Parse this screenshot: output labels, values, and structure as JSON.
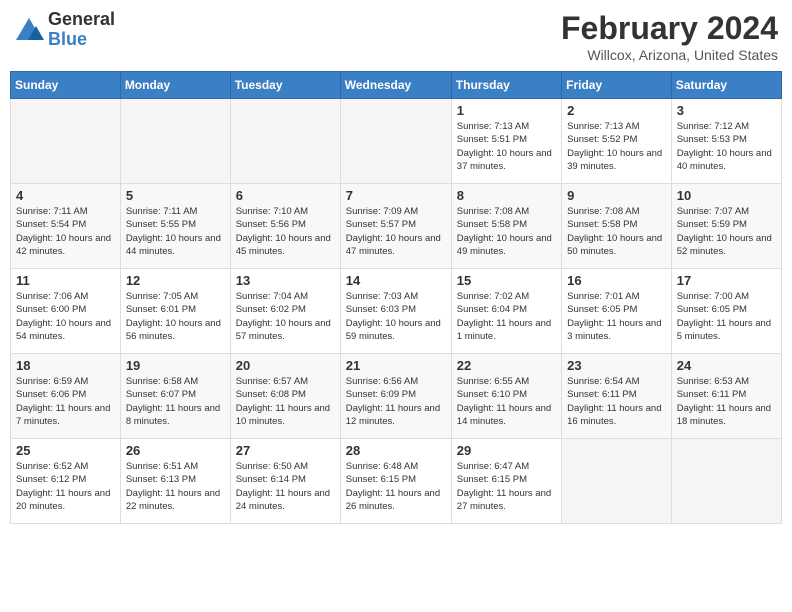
{
  "header": {
    "logo_general": "General",
    "logo_blue": "Blue",
    "month_title": "February 2024",
    "location": "Willcox, Arizona, United States"
  },
  "weekdays": [
    "Sunday",
    "Monday",
    "Tuesday",
    "Wednesday",
    "Thursday",
    "Friday",
    "Saturday"
  ],
  "weeks": [
    [
      {
        "day": "",
        "info": ""
      },
      {
        "day": "",
        "info": ""
      },
      {
        "day": "",
        "info": ""
      },
      {
        "day": "",
        "info": ""
      },
      {
        "day": "1",
        "info": "Sunrise: 7:13 AM\nSunset: 5:51 PM\nDaylight: 10 hours\nand 37 minutes."
      },
      {
        "day": "2",
        "info": "Sunrise: 7:13 AM\nSunset: 5:52 PM\nDaylight: 10 hours\nand 39 minutes."
      },
      {
        "day": "3",
        "info": "Sunrise: 7:12 AM\nSunset: 5:53 PM\nDaylight: 10 hours\nand 40 minutes."
      }
    ],
    [
      {
        "day": "4",
        "info": "Sunrise: 7:11 AM\nSunset: 5:54 PM\nDaylight: 10 hours\nand 42 minutes."
      },
      {
        "day": "5",
        "info": "Sunrise: 7:11 AM\nSunset: 5:55 PM\nDaylight: 10 hours\nand 44 minutes."
      },
      {
        "day": "6",
        "info": "Sunrise: 7:10 AM\nSunset: 5:56 PM\nDaylight: 10 hours\nand 45 minutes."
      },
      {
        "day": "7",
        "info": "Sunrise: 7:09 AM\nSunset: 5:57 PM\nDaylight: 10 hours\nand 47 minutes."
      },
      {
        "day": "8",
        "info": "Sunrise: 7:08 AM\nSunset: 5:58 PM\nDaylight: 10 hours\nand 49 minutes."
      },
      {
        "day": "9",
        "info": "Sunrise: 7:08 AM\nSunset: 5:58 PM\nDaylight: 10 hours\nand 50 minutes."
      },
      {
        "day": "10",
        "info": "Sunrise: 7:07 AM\nSunset: 5:59 PM\nDaylight: 10 hours\nand 52 minutes."
      }
    ],
    [
      {
        "day": "11",
        "info": "Sunrise: 7:06 AM\nSunset: 6:00 PM\nDaylight: 10 hours\nand 54 minutes."
      },
      {
        "day": "12",
        "info": "Sunrise: 7:05 AM\nSunset: 6:01 PM\nDaylight: 10 hours\nand 56 minutes."
      },
      {
        "day": "13",
        "info": "Sunrise: 7:04 AM\nSunset: 6:02 PM\nDaylight: 10 hours\nand 57 minutes."
      },
      {
        "day": "14",
        "info": "Sunrise: 7:03 AM\nSunset: 6:03 PM\nDaylight: 10 hours\nand 59 minutes."
      },
      {
        "day": "15",
        "info": "Sunrise: 7:02 AM\nSunset: 6:04 PM\nDaylight: 11 hours\nand 1 minute."
      },
      {
        "day": "16",
        "info": "Sunrise: 7:01 AM\nSunset: 6:05 PM\nDaylight: 11 hours\nand 3 minutes."
      },
      {
        "day": "17",
        "info": "Sunrise: 7:00 AM\nSunset: 6:05 PM\nDaylight: 11 hours\nand 5 minutes."
      }
    ],
    [
      {
        "day": "18",
        "info": "Sunrise: 6:59 AM\nSunset: 6:06 PM\nDaylight: 11 hours\nand 7 minutes."
      },
      {
        "day": "19",
        "info": "Sunrise: 6:58 AM\nSunset: 6:07 PM\nDaylight: 11 hours\nand 8 minutes."
      },
      {
        "day": "20",
        "info": "Sunrise: 6:57 AM\nSunset: 6:08 PM\nDaylight: 11 hours\nand 10 minutes."
      },
      {
        "day": "21",
        "info": "Sunrise: 6:56 AM\nSunset: 6:09 PM\nDaylight: 11 hours\nand 12 minutes."
      },
      {
        "day": "22",
        "info": "Sunrise: 6:55 AM\nSunset: 6:10 PM\nDaylight: 11 hours\nand 14 minutes."
      },
      {
        "day": "23",
        "info": "Sunrise: 6:54 AM\nSunset: 6:11 PM\nDaylight: 11 hours\nand 16 minutes."
      },
      {
        "day": "24",
        "info": "Sunrise: 6:53 AM\nSunset: 6:11 PM\nDaylight: 11 hours\nand 18 minutes."
      }
    ],
    [
      {
        "day": "25",
        "info": "Sunrise: 6:52 AM\nSunset: 6:12 PM\nDaylight: 11 hours\nand 20 minutes."
      },
      {
        "day": "26",
        "info": "Sunrise: 6:51 AM\nSunset: 6:13 PM\nDaylight: 11 hours\nand 22 minutes."
      },
      {
        "day": "27",
        "info": "Sunrise: 6:50 AM\nSunset: 6:14 PM\nDaylight: 11 hours\nand 24 minutes."
      },
      {
        "day": "28",
        "info": "Sunrise: 6:48 AM\nSunset: 6:15 PM\nDaylight: 11 hours\nand 26 minutes."
      },
      {
        "day": "29",
        "info": "Sunrise: 6:47 AM\nSunset: 6:15 PM\nDaylight: 11 hours\nand 27 minutes."
      },
      {
        "day": "",
        "info": ""
      },
      {
        "day": "",
        "info": ""
      }
    ]
  ]
}
